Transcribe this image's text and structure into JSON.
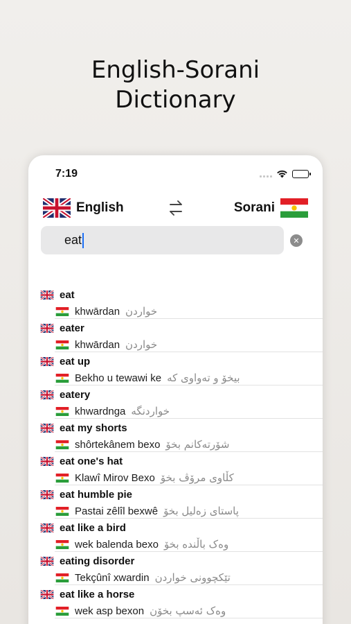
{
  "promo": {
    "title_line1": "English-Sorani",
    "title_line2": "Dictionary"
  },
  "status_bar": {
    "time": "7:19"
  },
  "language_bar": {
    "source_language": "English",
    "target_language": "Sorani"
  },
  "search": {
    "value": "eat"
  },
  "results": [
    {
      "english": "eat",
      "latin": "khwārdan",
      "sorani": "خواردن"
    },
    {
      "english": "eater",
      "latin": "khwārdan",
      "sorani": "خواردن"
    },
    {
      "english": "eat up",
      "latin": "Bekho u tewawi ke",
      "sorani": "بیخۆ و تەواوی کە"
    },
    {
      "english": "eatery",
      "latin": "khwardnga",
      "sorani": "خواردنگە"
    },
    {
      "english": "eat my shorts",
      "latin": "shôrtekânem bexo",
      "sorani": "شۆرتەکانم بخۆ"
    },
    {
      "english": "eat one's hat",
      "latin": "Klawî Mirov Bexo",
      "sorani": "کڵاوی مرۆڤ بخۆ"
    },
    {
      "english": "eat humble pie",
      "latin": "Pastai zêlîl bexwê",
      "sorani": "پاستای زەلیل بخۆ"
    },
    {
      "english": "eat like a bird",
      "latin": "wek balenda bexo",
      "sorani": "وەک باڵندە بخۆ"
    },
    {
      "english": "eating disorder",
      "latin": "Tekçûnî xwardin",
      "sorani": "تێکچوونی خواردن"
    },
    {
      "english": "eat like a horse",
      "latin": "wek asp bexon",
      "sorani": "وەک ئەسپ بخۆن"
    }
  ],
  "icons": {
    "uk_flag": "uk-flag-icon",
    "kurdistan_flag": "kurdistan-flag-icon",
    "swap": "swap-arrows-icon",
    "clear": "clear-icon",
    "wifi": "wifi-icon",
    "battery": "battery-icon",
    "signal": "signal-icon"
  },
  "colors": {
    "caret": "#1a6ef5",
    "flag_red": "#e21f26",
    "flag_green": "#2a9d3a",
    "flag_sun": "#f5c400",
    "uk_blue": "#1f2e6e",
    "uk_red": "#c8102e"
  }
}
